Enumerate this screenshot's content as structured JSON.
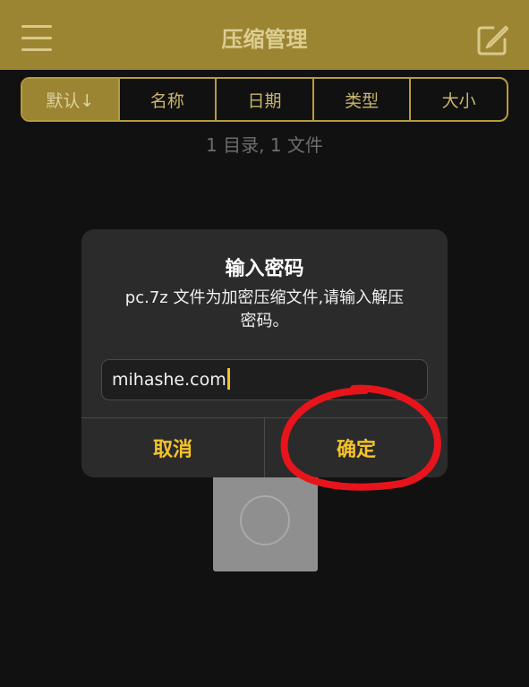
{
  "navbar": {
    "title": "压缩管理",
    "menu_icon": "hamburger-menu-icon",
    "edit_icon": "edit-square-icon",
    "accent_color": "#9c8532"
  },
  "sort_tabs": [
    {
      "label": "默认↓",
      "active": true
    },
    {
      "label": "名称",
      "active": false
    },
    {
      "label": "日期",
      "active": false
    },
    {
      "label": "类型",
      "active": false
    },
    {
      "label": "大小",
      "active": false
    }
  ],
  "summary": "1 目录, 1 文件",
  "dialog": {
    "title": "输入密码",
    "message_line1": "pc.7z 文件为加密压缩文件,请输入解压",
    "message_line2": "密码。",
    "input_value": "mihashe.com",
    "cancel_label": "取消",
    "confirm_label": "确定",
    "button_color": "#f4c22c"
  },
  "annotation": {
    "type": "red-circle-highlight",
    "target": "确定",
    "color": "#e8141c"
  }
}
